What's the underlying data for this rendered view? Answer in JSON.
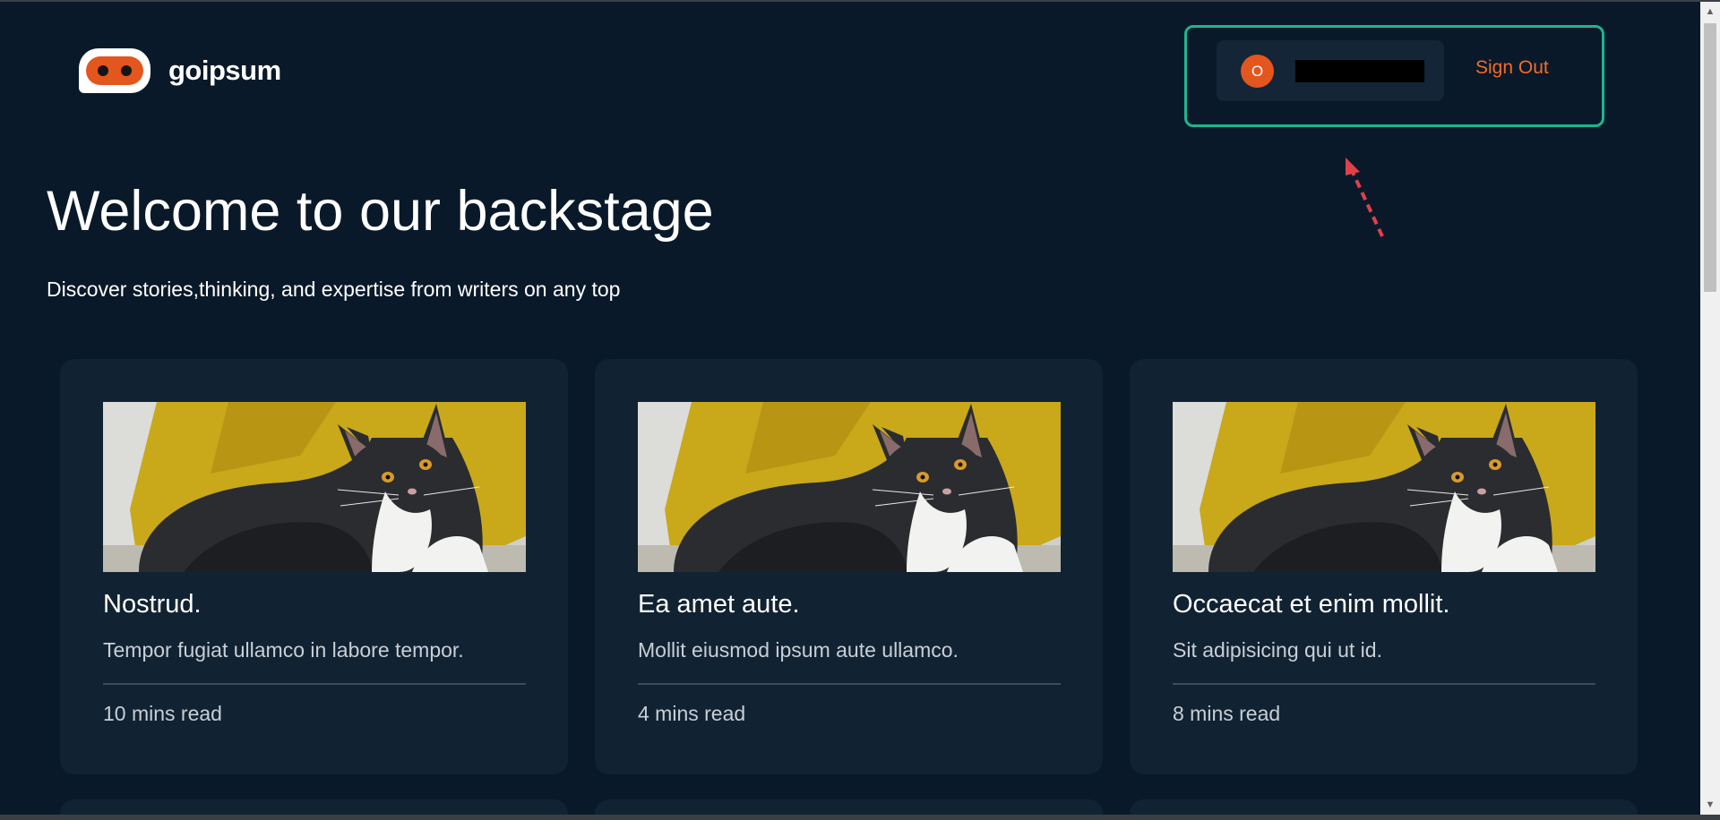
{
  "brand": {
    "name": "goipsum",
    "color": "#e3561e"
  },
  "user": {
    "avatar_initial": "O",
    "name": ""
  },
  "header": {
    "signout_label": "Sign Out",
    "signout_color": "#f26c2a",
    "panel_border_color": "#1db58f"
  },
  "hero": {
    "title": "Welcome to our backstage",
    "subtitle": "Discover stories,thinking, and expertise from writers on any top"
  },
  "posts": [
    {
      "title": "Nostrud.",
      "description": "Tempor fugiat ullamco in labore tempor.",
      "read_time": "10 mins read",
      "image": "cat-photo"
    },
    {
      "title": "Ea amet aute.",
      "description": "Mollit eiusmod ipsum aute ullamco.",
      "read_time": "4 mins read",
      "image": "cat-photo"
    },
    {
      "title": "Occaecat et enim mollit.",
      "description": "Sit adipisicing qui ut id.",
      "read_time": "8 mins read",
      "image": "cat-photo"
    }
  ],
  "colors": {
    "background": "#0a1929",
    "card": "#112233",
    "annotation_arrow": "#e0404a"
  }
}
